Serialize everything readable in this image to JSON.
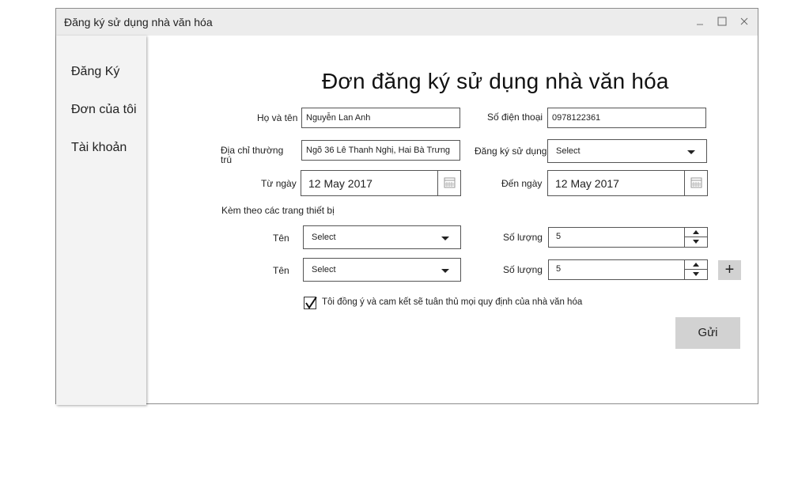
{
  "window": {
    "title": "Đăng ký sử dụng nhà văn hóa",
    "controls": [
      "minimize-icon",
      "maximize-icon",
      "close-icon"
    ]
  },
  "sidebar": {
    "items": [
      {
        "label": "Đăng Ký"
      },
      {
        "label": "Đơn của tôi"
      },
      {
        "label": "Tài khoản"
      }
    ]
  },
  "form": {
    "heading": "Đơn đăng ký sử dụng nhà văn hóa",
    "full_name": {
      "label": "Họ và tên",
      "value": "Nguyễn Lan Anh"
    },
    "phone": {
      "label": "Số điện thoại",
      "value": "0978122361"
    },
    "address": {
      "label_line1": "Địa chỉ thường",
      "label_line2": "trú",
      "value": "Ngõ 36 Lê Thanh Nghị, Hai Bà Trưng"
    },
    "register_use": {
      "label": "Đăng ký sử dụng",
      "value": "Select"
    },
    "from_date": {
      "label": "Từ ngày",
      "value": "12 May 2017",
      "icon": "calendar-icon"
    },
    "to_date": {
      "label": "Đến ngày",
      "value": "12 May 2017",
      "icon": "calendar-icon"
    },
    "equipment_section_label": "Kèm theo các trang thiết bị",
    "equipment_rows": [
      {
        "name_label": "Tên",
        "name_value": "Select",
        "qty_label": "Số lượng",
        "qty_value": "5"
      },
      {
        "name_label": "Tên",
        "name_value": "Select",
        "qty_label": "Số lượng",
        "qty_value": "5"
      }
    ],
    "add_button": "+",
    "agreement": {
      "checked": true,
      "text": "Tôi đồng ý và cam kết sẽ tuân thủ mọi quy định của nhà văn hóa"
    },
    "submit_label": "Gửi"
  },
  "colors": {
    "titlebar": "#ececec",
    "sidebar": "#f3f3f3",
    "button": "#d2d2d2",
    "border": "#555555"
  }
}
